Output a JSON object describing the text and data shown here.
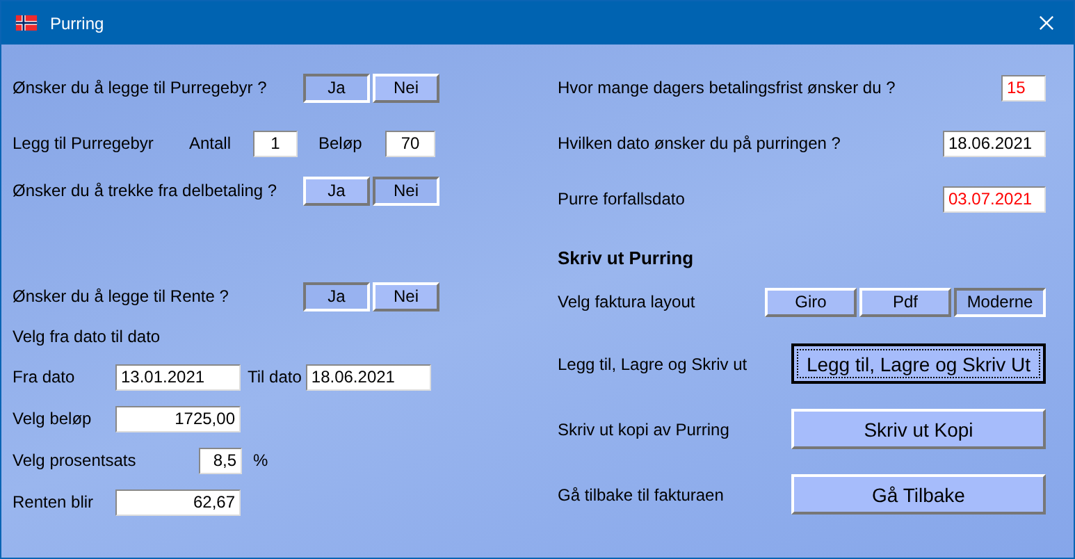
{
  "window": {
    "title": "Purring"
  },
  "fee_question": {
    "label": "Ønsker du å legge til Purregebyr ?",
    "options": [
      {
        "label": "Ja",
        "selected": true
      },
      {
        "label": "Nei",
        "selected": false
      }
    ]
  },
  "fee_row": {
    "label": "Legg til Purregebyr",
    "count_label": "Antall",
    "count": "1",
    "amount_label": "Beløp",
    "amount": "70"
  },
  "partial_question": {
    "label": "Ønsker du å trekke fra delbetaling ?",
    "options": [
      {
        "label": "Ja",
        "selected": false
      },
      {
        "label": "Nei",
        "selected": true
      }
    ]
  },
  "interest_question": {
    "label": "Ønsker du å legge til Rente ?",
    "options": [
      {
        "label": "Ja",
        "selected": true
      },
      {
        "label": "Nei",
        "selected": false
      }
    ]
  },
  "date_range": {
    "heading": "Velg fra dato til dato",
    "from_label": "Fra dato",
    "from": "13.01.2021",
    "to_label": "Til dato",
    "to": "18.06.2021"
  },
  "amount": {
    "label": "Velg beløp",
    "value": "1725,00"
  },
  "rate": {
    "label": "Velg prosentsats",
    "value": "8,5",
    "unit": "%"
  },
  "interest_result": {
    "label": "Renten blir",
    "value": "62,67"
  },
  "settings": [
    {
      "label": "Hvor mange dagers betalingsfrist ønsker du ?",
      "value": "15",
      "alert": true,
      "kind": "short"
    },
    {
      "label": "Hvilken dato ønsker du på purringen ?",
      "value": "18.06.2021",
      "alert": false,
      "kind": "date"
    },
    {
      "label": "Purre forfallsdato",
      "value": "03.07.2021",
      "alert": true,
      "kind": "date"
    }
  ],
  "print_heading": "Skriv ut Purring",
  "layout": {
    "label": "Velg faktura layout",
    "options": [
      {
        "label": "Giro",
        "selected": false
      },
      {
        "label": "Pdf",
        "selected": false
      },
      {
        "label": "Moderne",
        "selected": true
      }
    ]
  },
  "actions": [
    {
      "label": "Legg til, Lagre og Skriv ut",
      "button": "Legg til, Lagre og Skriv Ut",
      "focused": true
    },
    {
      "label": "Skriv ut kopi av Purring",
      "button": "Skriv ut Kopi",
      "focused": false
    },
    {
      "label": "Gå tilbake til fakturaen",
      "button": "Gå Tilbake",
      "focused": false
    }
  ]
}
